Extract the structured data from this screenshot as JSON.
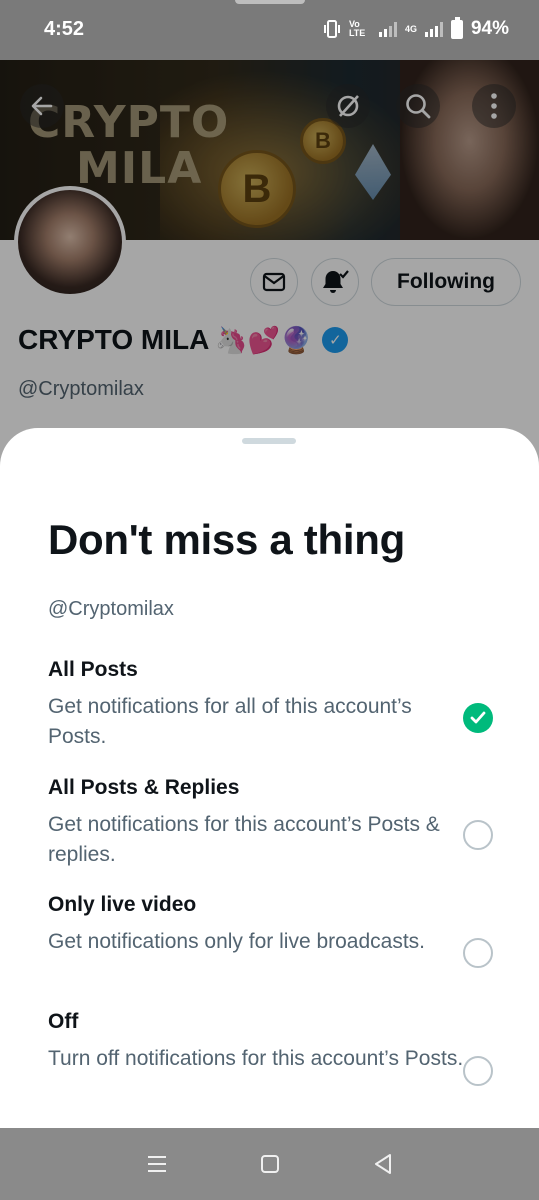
{
  "status_bar": {
    "time": "4:52",
    "network_volte": "Vo LTE",
    "network_gen": "4G",
    "battery": "94%"
  },
  "banner": {
    "text_line1": "CRYPTO",
    "text_line2": "MILA",
    "coin_symbol": "B"
  },
  "profile": {
    "name": "CRYPTO MILA",
    "name_emojis": "🦄💕🔮",
    "handle": "@Cryptomilax",
    "follow_label": "Following"
  },
  "sheet": {
    "title": "Don't miss a thing",
    "handle": "@Cryptomilax",
    "options": [
      {
        "title": "All Posts",
        "desc": "Get notifications for all of this account’s Posts.",
        "selected": true
      },
      {
        "title": "All Posts & Replies",
        "desc": "Get notifications for this account’s Posts & replies.",
        "selected": false
      },
      {
        "title": "Only live video",
        "desc": "Get notifications only for live broadcasts.",
        "selected": false
      },
      {
        "title": "Off",
        "desc": "Turn off notifications for this account’s Posts.",
        "selected": false
      }
    ]
  },
  "colors": {
    "accent_green": "#00ba7c",
    "verified_blue": "#1d9bf0",
    "text_primary": "#0f1419",
    "text_secondary": "#536471"
  },
  "icons": {
    "back": "back-arrow-icon",
    "translate": "translate-icon",
    "search": "search-icon",
    "more": "more-vertical-icon",
    "message": "message-icon",
    "notifications": "bell-check-icon",
    "nav_menu": "menu-icon",
    "nav_home": "home-square-icon",
    "nav_back": "nav-back-icon"
  }
}
